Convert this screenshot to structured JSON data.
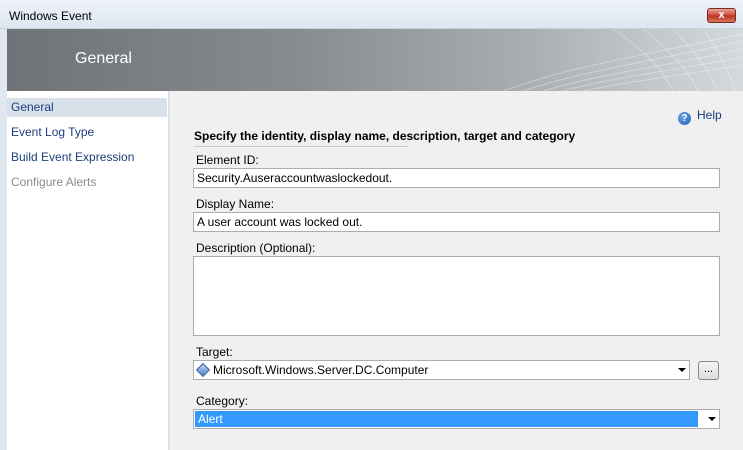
{
  "window": {
    "title": "Windows Event",
    "close_label": "x"
  },
  "banner": {
    "title": "General"
  },
  "nav": {
    "items": [
      {
        "label": "General"
      },
      {
        "label": "Event Log Type"
      },
      {
        "label": "Build Event Expression"
      },
      {
        "label": "Configure Alerts"
      }
    ]
  },
  "help": {
    "label": "Help",
    "icon": "help-icon"
  },
  "form": {
    "heading": "Specify the identity, display name, description, target and category",
    "element_id": {
      "label": "Element ID:",
      "value": "Security.Auseraccountwaslockedout."
    },
    "display_name": {
      "label": "Display Name:",
      "value": "A user account was locked out."
    },
    "description": {
      "label": "Description (Optional):",
      "value": ""
    },
    "target": {
      "label": "Target:",
      "value": "Microsoft.Windows.Server.DC.Computer",
      "browse_label": "..."
    },
    "category": {
      "label": "Category:",
      "value": "Alert"
    }
  },
  "colors": {
    "selection": "#3399ff",
    "nav_text": "#1a3e7a",
    "nav_selected": "#d8e0ea"
  }
}
